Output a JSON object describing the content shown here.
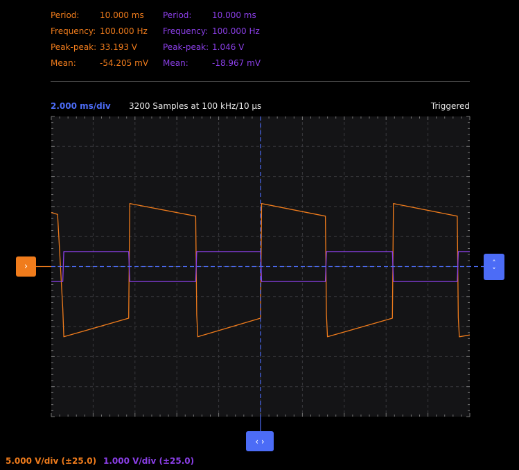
{
  "measurements": {
    "ch1": {
      "rows": [
        {
          "label": "Period:",
          "value": "10.000 ms"
        },
        {
          "label": "Frequency:",
          "value": "100.000 Hz"
        },
        {
          "label": "Peak-peak:",
          "value": "33.193 V"
        },
        {
          "label": "Mean:",
          "value": "-54.205 mV"
        }
      ]
    },
    "ch2": {
      "rows": [
        {
          "label": "Period:",
          "value": "10.000 ms"
        },
        {
          "label": "Frequency:",
          "value": "100.000 Hz"
        },
        {
          "label": "Peak-peak:",
          "value": "1.046 V"
        },
        {
          "label": "Mean:",
          "value": "-18.967 mV"
        }
      ]
    }
  },
  "header": {
    "timebase": "2.000 ms/div",
    "samples": "3200 Samples at 100 kHz/10 µs",
    "trigger_status": "Triggered"
  },
  "footer": {
    "ch1_vdiv": "5.000 V/div (±25.0)",
    "ch2_vdiv": "1.000 V/div (±25.0)"
  },
  "markers": {
    "ch1_offset_icon": "›",
    "trigger_up_icon": "˄",
    "trigger_down_icon": "˅",
    "time_pan_icon": "‹ ›"
  },
  "colors": {
    "ch1": "#f07c1c",
    "ch2": "#8b3fe8",
    "accent": "#4c6cf6",
    "grid_bg": "#141416"
  },
  "chart_data": {
    "type": "line",
    "x_divisions": 10,
    "y_divisions": 10,
    "x_unit_per_div_ms": 2,
    "series": [
      {
        "name": "CH1",
        "volts_per_div": 5,
        "points_ms_v": [
          [
            0,
            9.0
          ],
          [
            0.3,
            8.7
          ],
          [
            0.55,
            -7.0
          ],
          [
            0.6,
            -11.7
          ],
          [
            3.7,
            -8.6
          ],
          [
            3.75,
            10.5
          ],
          [
            6.9,
            8.4
          ],
          [
            6.95,
            -8.0
          ],
          [
            7.0,
            -11.7
          ],
          [
            10.0,
            -8.6
          ],
          [
            10.05,
            10.5
          ],
          [
            13.1,
            8.4
          ],
          [
            13.15,
            -8.0
          ],
          [
            13.2,
            -11.7
          ],
          [
            16.3,
            -8.6
          ],
          [
            16.35,
            10.5
          ],
          [
            19.4,
            8.4
          ],
          [
            19.45,
            -8.5
          ],
          [
            19.5,
            -11.7
          ],
          [
            20,
            -11.4
          ]
        ]
      },
      {
        "name": "CH2",
        "volts_per_div": 1,
        "points_ms_v": [
          [
            0,
            -0.5
          ],
          [
            0.55,
            -0.5
          ],
          [
            0.6,
            0.5
          ],
          [
            3.7,
            0.5
          ],
          [
            3.75,
            -0.5
          ],
          [
            6.9,
            -0.5
          ],
          [
            6.95,
            0.5
          ],
          [
            10.0,
            0.5
          ],
          [
            10.05,
            -0.5
          ],
          [
            13.1,
            -0.5
          ],
          [
            13.15,
            0.5
          ],
          [
            16.3,
            0.5
          ],
          [
            16.35,
            -0.5
          ],
          [
            19.4,
            -0.5
          ],
          [
            19.45,
            0.5
          ],
          [
            20,
            0.5
          ]
        ]
      }
    ]
  }
}
